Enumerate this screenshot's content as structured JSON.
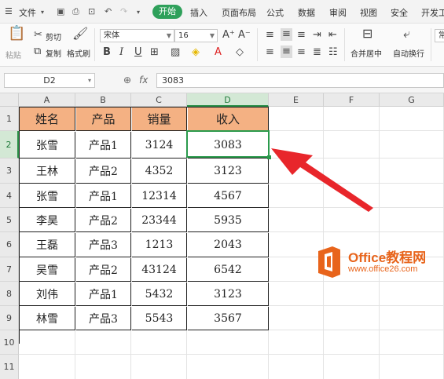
{
  "menubar": {
    "file_label": "文件",
    "tabs": [
      "开始",
      "插入",
      "页面布局",
      "公式",
      "数据",
      "审阅",
      "视图",
      "安全",
      "开发工"
    ]
  },
  "ribbon": {
    "paste": "粘贴",
    "cut": "剪切",
    "copy": "复制",
    "format_painter": "格式刷",
    "font_name": "宋体",
    "font_size": "16",
    "merge_center": "合并居中",
    "wrap_text": "自动换行",
    "more": "常"
  },
  "formula_bar": {
    "cell_ref": "D2",
    "fx": "fx",
    "value": "3083"
  },
  "sheet": {
    "columns": [
      "A",
      "B",
      "C",
      "D",
      "E",
      "F",
      "G"
    ],
    "rows": [
      "1",
      "2",
      "3",
      "4",
      "5",
      "6",
      "7",
      "8",
      "9",
      "10",
      "11"
    ],
    "active_cell": "D2",
    "table": {
      "header": [
        "姓名",
        "产品",
        "销量",
        "收入"
      ],
      "header_fill": "#f4b183",
      "rows": [
        [
          "张雪",
          "产品1",
          "3124",
          "3083"
        ],
        [
          "王林",
          "产品2",
          "4352",
          "3123"
        ],
        [
          "张雪",
          "产品1",
          "12314",
          "4567"
        ],
        [
          "李昊",
          "产品2",
          "23344",
          "5935"
        ],
        [
          "王磊",
          "产品3",
          "1213",
          "2043"
        ],
        [
          "吴雪",
          "产品2",
          "43124",
          "6542"
        ],
        [
          "刘伟",
          "产品1",
          "5432",
          "3123"
        ],
        [
          "林雪",
          "产品3",
          "5543",
          "3567"
        ]
      ]
    }
  },
  "annotation": {
    "arrow_color": "#e8262b"
  },
  "watermark": {
    "brand": "Office教程网",
    "url": "www.office26.com",
    "color": "#e8641b"
  }
}
